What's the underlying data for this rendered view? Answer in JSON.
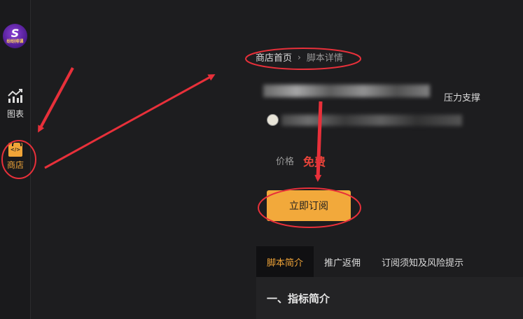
{
  "sidebar": {
    "logo": {
      "glyph": "S",
      "text": "纷纷排课"
    },
    "items": [
      {
        "label": "图表",
        "icon": "bar-chart-icon"
      },
      {
        "label": "商店",
        "icon": "store-bag-icon",
        "active": true
      }
    ]
  },
  "breadcrumb": {
    "home": "商店首页",
    "separator": "›",
    "current": "脚本详情"
  },
  "script": {
    "name_suffix": "压力支撑",
    "price_label": "价格",
    "price_value": "免费"
  },
  "actions": {
    "subscribe_label": "立即订阅"
  },
  "tabs": [
    {
      "label": "脚本简介",
      "active": true
    },
    {
      "label": "推广返佣",
      "active": false
    },
    {
      "label": "订阅须知及风险提示",
      "active": false
    }
  ],
  "content": {
    "section_title": "一、指标简介"
  },
  "colors": {
    "accent": "#f2a93b",
    "price": "#e8443a",
    "annotation": "#e8303a",
    "background": "#1d1d1f"
  }
}
